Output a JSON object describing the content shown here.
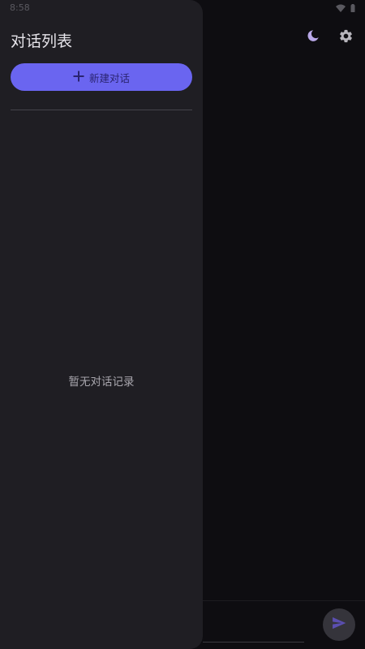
{
  "status_bar": {
    "time": "8:58",
    "icons": [
      "wifi-icon",
      "battery-icon"
    ]
  },
  "header": {
    "icons": [
      "moon-icon",
      "gear-icon"
    ]
  },
  "drawer": {
    "title": "对话列表",
    "new_chat_label": "新建对话",
    "new_chat_icon": "plus-icon",
    "empty_text": "暂无对话记录"
  },
  "composer": {
    "send_icon": "send-icon"
  },
  "colors": {
    "background": "#0e0d11",
    "drawer_background": "#1f1e23",
    "accent": "#6a65f0",
    "accent_text": "#2a2470",
    "moon_icon": "#b9a8e8",
    "send_button": "#35343b",
    "send_icon": "#5b4fb0"
  }
}
